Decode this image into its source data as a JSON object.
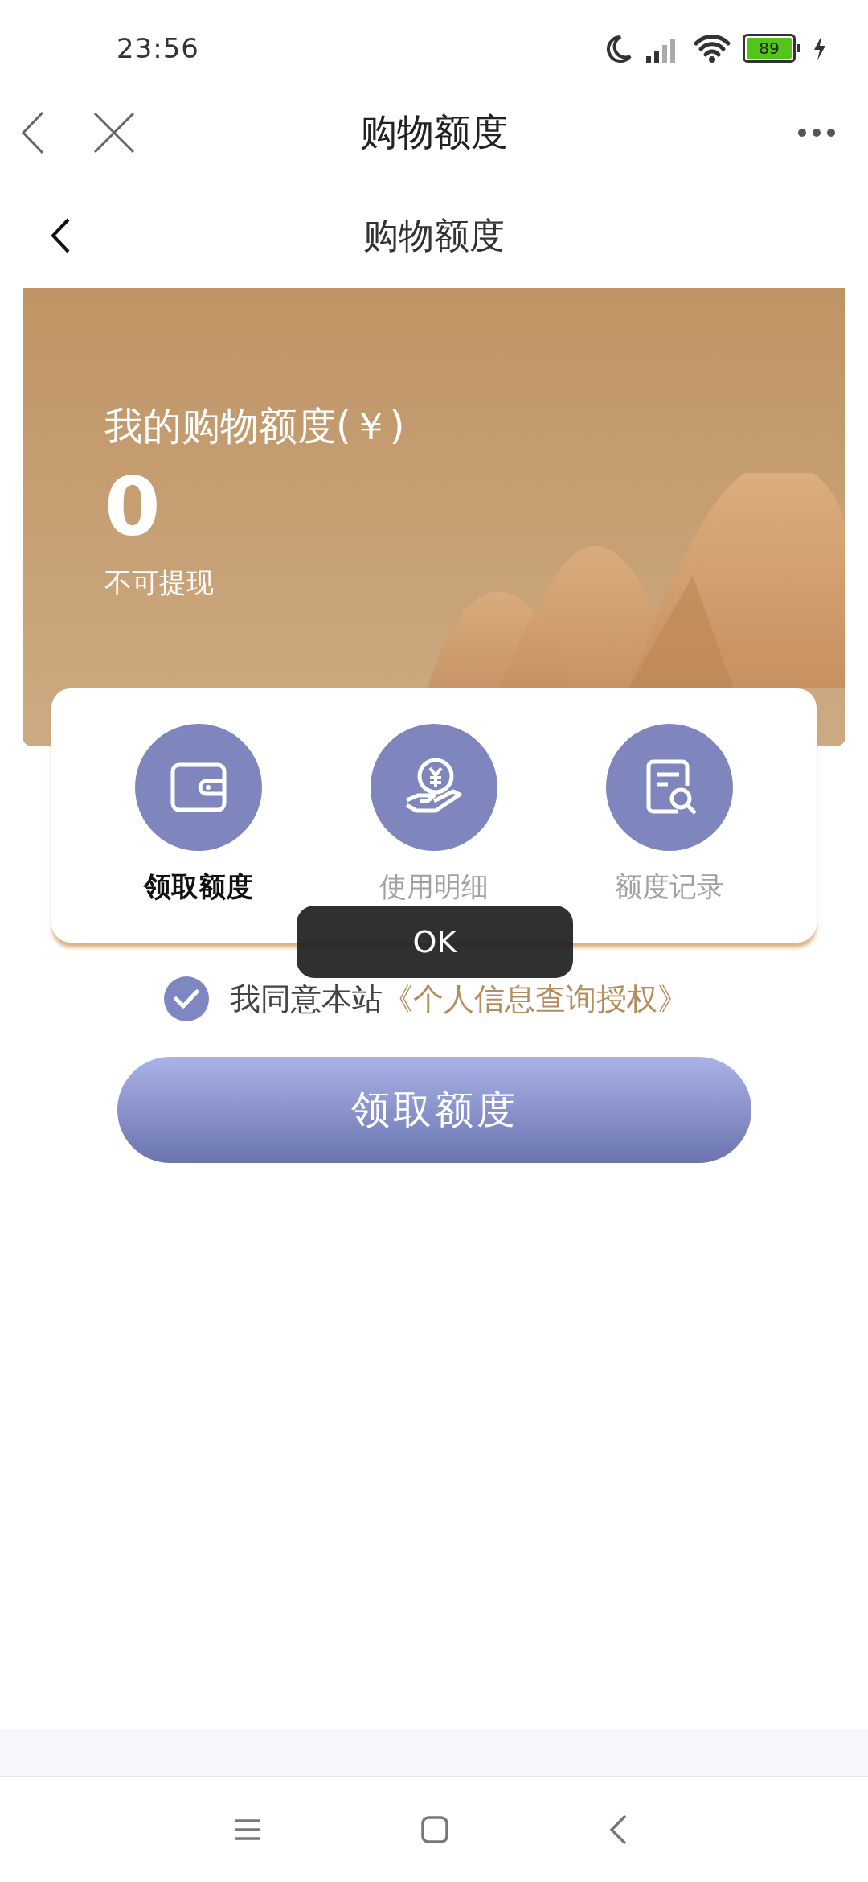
{
  "status_bar": {
    "time": "23:56",
    "battery": "89"
  },
  "app_bar": {
    "title": "购物额度"
  },
  "page_header": {
    "title": "购物额度"
  },
  "quota_card": {
    "label": "我的购物额度(￥)",
    "amount": "0",
    "note": "不可提现"
  },
  "menu": [
    {
      "kind": "wallet",
      "label": "领取额度",
      "selected": true
    },
    {
      "kind": "yuan-hand",
      "label": "使用明细",
      "selected": false
    },
    {
      "kind": "record-search",
      "label": "额度记录",
      "selected": false
    }
  ],
  "agreement": {
    "checked": true,
    "text": "我同意本站",
    "link": "《个人信息查询授权》"
  },
  "claim_button": {
    "label": "领取额度"
  },
  "toast": {
    "text": "OK"
  }
}
